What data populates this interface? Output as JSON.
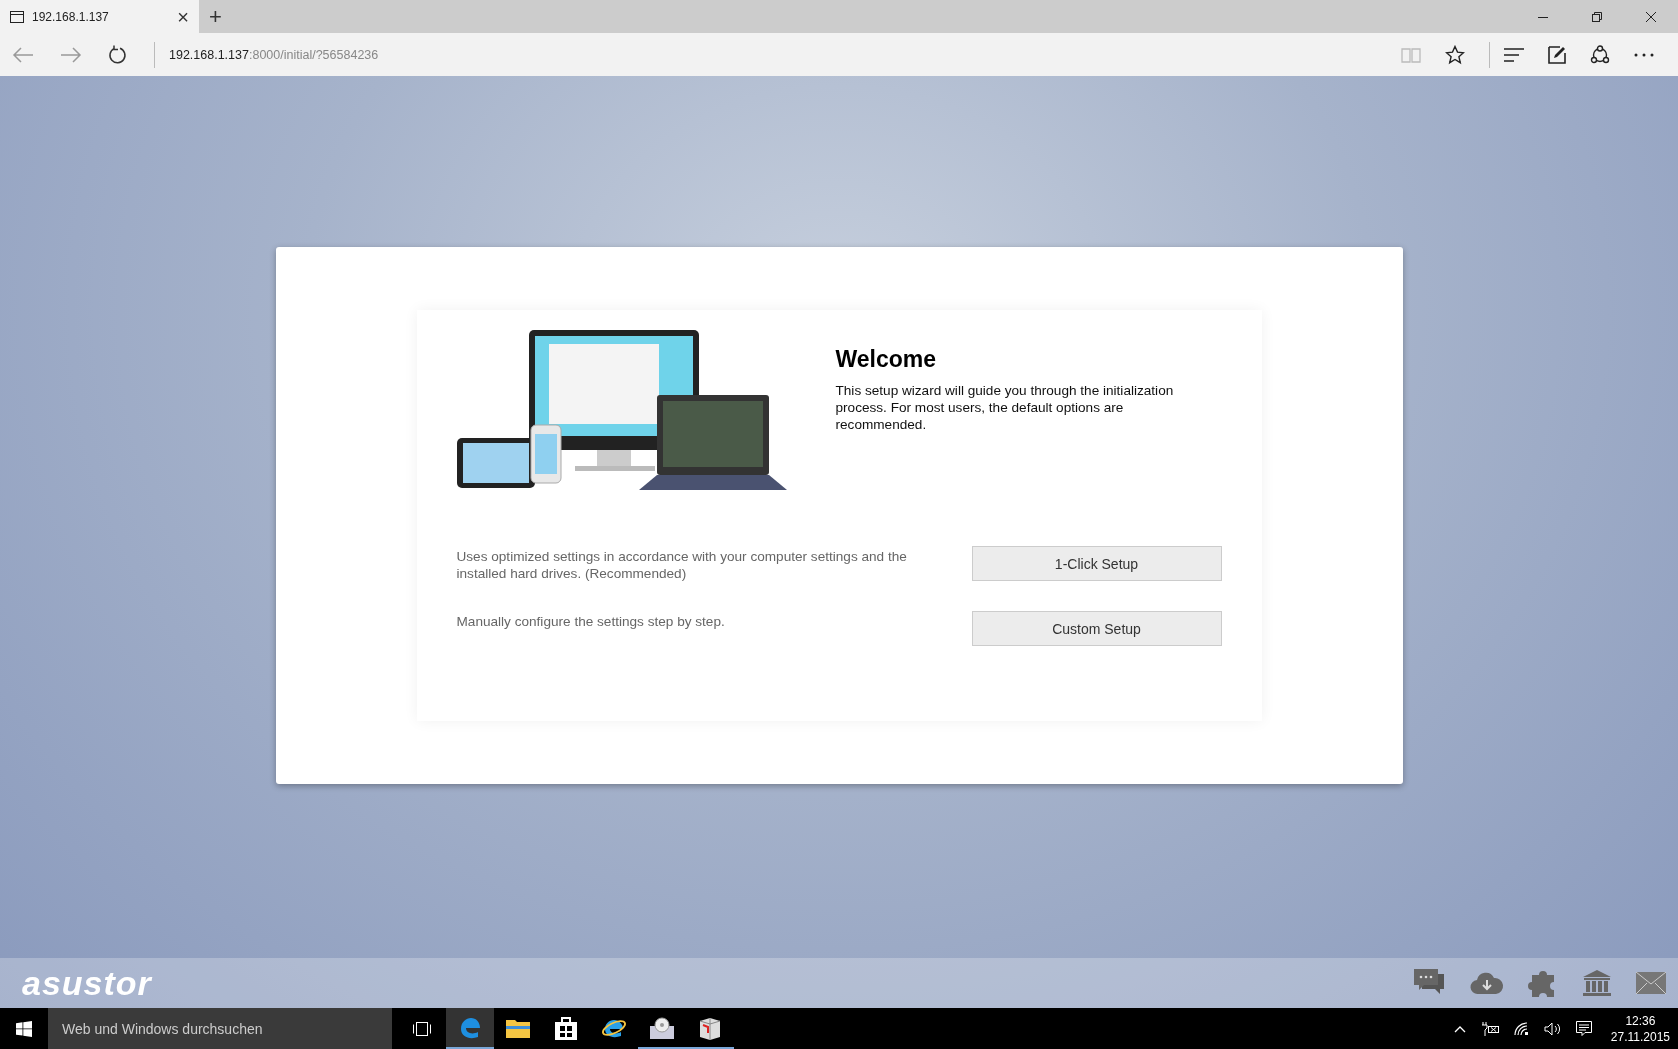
{
  "browser": {
    "tab": {
      "title": "192.168.1.137",
      "close": "×",
      "selected": true
    },
    "new_tab": "+",
    "address": {
      "host": "192.168.1.137",
      "rest": ":8000/initial/?56584236"
    }
  },
  "dialog": {
    "title": "Welcome",
    "intro": "This setup wizard will guide you through the initialization process. For most users, the default options are recommended.",
    "options": [
      {
        "description": "Uses optimized settings in accordance with your computer settings and the installed hard drives. (Recommended)",
        "button": "1-Click Setup"
      },
      {
        "description": "Manually configure the settings step by step.",
        "button": "Custom Setup"
      }
    ]
  },
  "brand_bar": {
    "logo": "asustor"
  },
  "taskbar": {
    "search": {
      "placeholder": "Web und Windows durchsuchen"
    },
    "apps": [
      {
        "kind": "edge",
        "selected": true,
        "running": true
      },
      {
        "kind": "explorer",
        "selected": false,
        "running": false
      },
      {
        "kind": "store",
        "selected": false,
        "running": false
      },
      {
        "kind": "ie",
        "selected": false,
        "running": false
      },
      {
        "kind": "installer",
        "selected": false,
        "running": true
      },
      {
        "kind": "tool",
        "selected": false,
        "running": true
      }
    ],
    "clock": {
      "time": "12:36",
      "date": "27.11.2015"
    }
  }
}
